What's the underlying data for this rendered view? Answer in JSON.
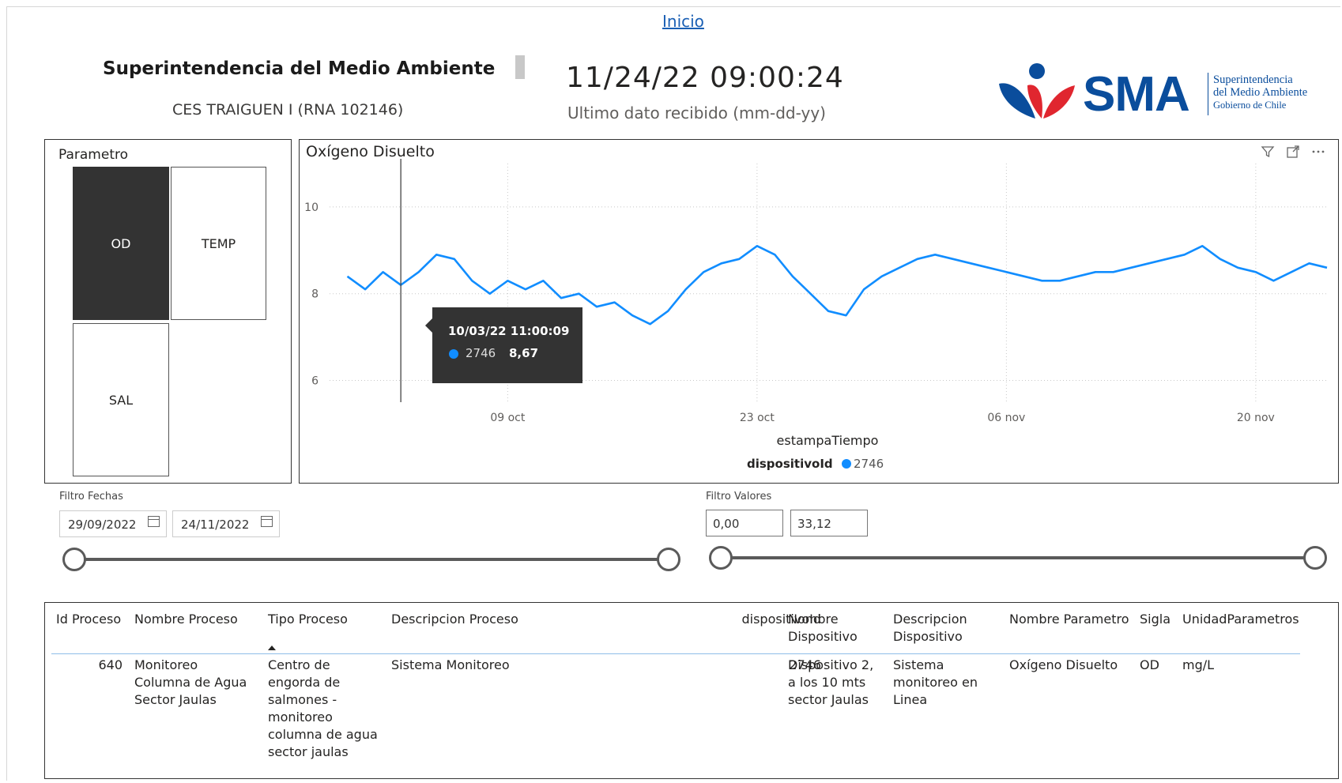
{
  "nav": {
    "home_link": "Inicio"
  },
  "header": {
    "org_title": "Superintendencia del Medio Ambiente",
    "site_name": "CES TRAIGUEN I (RNA 102146)",
    "timestamp": "11/24/22 09:00:24",
    "timestamp_label": "Ultimo dato recibido (mm-dd-yy)"
  },
  "logo": {
    "acronym": "SMA",
    "line1": "Superintendencia",
    "line2": "del Medio Ambiente",
    "line3": "Gobierno de Chile",
    "colors": {
      "blue": "#0a4d9c",
      "red": "#e0262f"
    }
  },
  "slicer": {
    "title": "Parametro",
    "options": [
      {
        "label": "OD",
        "selected": true
      },
      {
        "label": "TEMP",
        "selected": false
      },
      {
        "label": "SAL",
        "selected": false
      }
    ]
  },
  "chart_header": {
    "title": "Oxígeno Disuelto",
    "icons": [
      "filter-icon",
      "focus-mode-icon",
      "more-options-icon"
    ]
  },
  "chart_data": {
    "type": "line",
    "title": "Oxígeno Disuelto",
    "xlabel": "estampaTiempo",
    "ylabel": "",
    "x_range": [
      "2022-09-29",
      "2022-11-24"
    ],
    "x_ticks": [
      {
        "date": "2022-10-09",
        "label": "09 oct"
      },
      {
        "date": "2022-10-23",
        "label": "23 oct"
      },
      {
        "date": "2022-11-06",
        "label": "06 nov"
      },
      {
        "date": "2022-11-20",
        "label": "20 nov"
      }
    ],
    "ylim": [
      5.5,
      11
    ],
    "y_ticks": [
      6,
      8,
      10
    ],
    "grid": true,
    "legend": {
      "title": "dispositivoId",
      "entries": [
        "2746"
      ],
      "position": "bottom"
    },
    "series": [
      {
        "name": "2746",
        "color": "#118dff",
        "points": [
          [
            "2022-09-30",
            8.4
          ],
          [
            "2022-10-01",
            8.1
          ],
          [
            "2022-10-02",
            8.5
          ],
          [
            "2022-10-03",
            8.2
          ],
          [
            "2022-10-04",
            8.5
          ],
          [
            "2022-10-05",
            8.9
          ],
          [
            "2022-10-06",
            8.8
          ],
          [
            "2022-10-07",
            8.3
          ],
          [
            "2022-10-08",
            8.0
          ],
          [
            "2022-10-09",
            8.3
          ],
          [
            "2022-10-10",
            8.1
          ],
          [
            "2022-10-11",
            8.3
          ],
          [
            "2022-10-12",
            7.9
          ],
          [
            "2022-10-13",
            8.0
          ],
          [
            "2022-10-14",
            7.7
          ],
          [
            "2022-10-15",
            7.8
          ],
          [
            "2022-10-16",
            7.5
          ],
          [
            "2022-10-17",
            7.3
          ],
          [
            "2022-10-18",
            7.6
          ],
          [
            "2022-10-19",
            8.1
          ],
          [
            "2022-10-20",
            8.5
          ],
          [
            "2022-10-21",
            8.7
          ],
          [
            "2022-10-22",
            8.8
          ],
          [
            "2022-10-23",
            9.1
          ],
          [
            "2022-10-24",
            8.9
          ],
          [
            "2022-10-25",
            8.4
          ],
          [
            "2022-10-26",
            8.0
          ],
          [
            "2022-10-27",
            7.6
          ],
          [
            "2022-10-28",
            7.5
          ],
          [
            "2022-10-29",
            8.1
          ],
          [
            "2022-10-30",
            8.4
          ],
          [
            "2022-10-31",
            8.6
          ],
          [
            "2022-11-01",
            8.8
          ],
          [
            "2022-11-02",
            8.9
          ],
          [
            "2022-11-03",
            8.8
          ],
          [
            "2022-11-04",
            8.7
          ],
          [
            "2022-11-05",
            8.6
          ],
          [
            "2022-11-06",
            8.5
          ],
          [
            "2022-11-07",
            8.4
          ],
          [
            "2022-11-08",
            8.3
          ],
          [
            "2022-11-09",
            8.3
          ],
          [
            "2022-11-10",
            8.4
          ],
          [
            "2022-11-11",
            8.5
          ],
          [
            "2022-11-12",
            8.5
          ],
          [
            "2022-11-13",
            8.6
          ],
          [
            "2022-11-14",
            8.7
          ],
          [
            "2022-11-15",
            8.8
          ],
          [
            "2022-11-16",
            8.9
          ],
          [
            "2022-11-17",
            9.1
          ],
          [
            "2022-11-18",
            8.8
          ],
          [
            "2022-11-19",
            8.6
          ],
          [
            "2022-11-20",
            8.5
          ],
          [
            "2022-11-21",
            8.3
          ],
          [
            "2022-11-22",
            8.5
          ],
          [
            "2022-11-23",
            8.7
          ],
          [
            "2022-11-24",
            8.6
          ]
        ]
      }
    ],
    "hover_line_date": "2022-10-03",
    "tooltip": {
      "datetime": "10/03/22 11:00:09",
      "device": "2746",
      "value": "8,67"
    }
  },
  "date_filter": {
    "label": "Filtro Fechas",
    "start": "29/09/2022",
    "end": "24/11/2022",
    "range_selected": [
      0,
      1
    ]
  },
  "value_filter": {
    "label": "Filtro Valores",
    "min": "0,00",
    "max": "33,12",
    "range_selected": [
      0,
      1
    ]
  },
  "table": {
    "headers": {
      "id_proceso": "Id Proceso",
      "nombre_proceso": "Nombre Proceso",
      "tipo_proceso": "Tipo Proceso",
      "descripcion_proceso": "Descripcion Proceso",
      "dispositivo_id": "dispositivoId",
      "nombre_dispositivo_1": "Nombre",
      "nombre_dispositivo_2": "Dispositivo",
      "descripcion_dispositivo_1": "Descripcion",
      "descripcion_dispositivo_2": "Dispositivo",
      "nombre_parametro": "Nombre Parametro",
      "sigla": "Sigla",
      "unidad": "UnidadParametros"
    },
    "row": {
      "id_proceso": "640",
      "nombre_proceso": [
        "Monitoreo",
        "Columna de Agua",
        "Sector Jaulas"
      ],
      "tipo_proceso": [
        "Centro de",
        "engorda de",
        "salmones -",
        "monitoreo",
        "columna de agua",
        "sector jaulas"
      ],
      "descripcion_proceso": "Sistema Monitoreo",
      "dispositivo_id": "2746",
      "nombre_dispositivo": [
        "Dispositivo 2,",
        "a los 10 mts",
        "sector Jaulas"
      ],
      "descripcion_dispositivo": [
        "Sistema",
        "monitoreo en",
        "Linea"
      ],
      "nombre_parametro": "Oxígeno Disuelto",
      "sigla": "OD",
      "unidad": "mg/L"
    }
  }
}
